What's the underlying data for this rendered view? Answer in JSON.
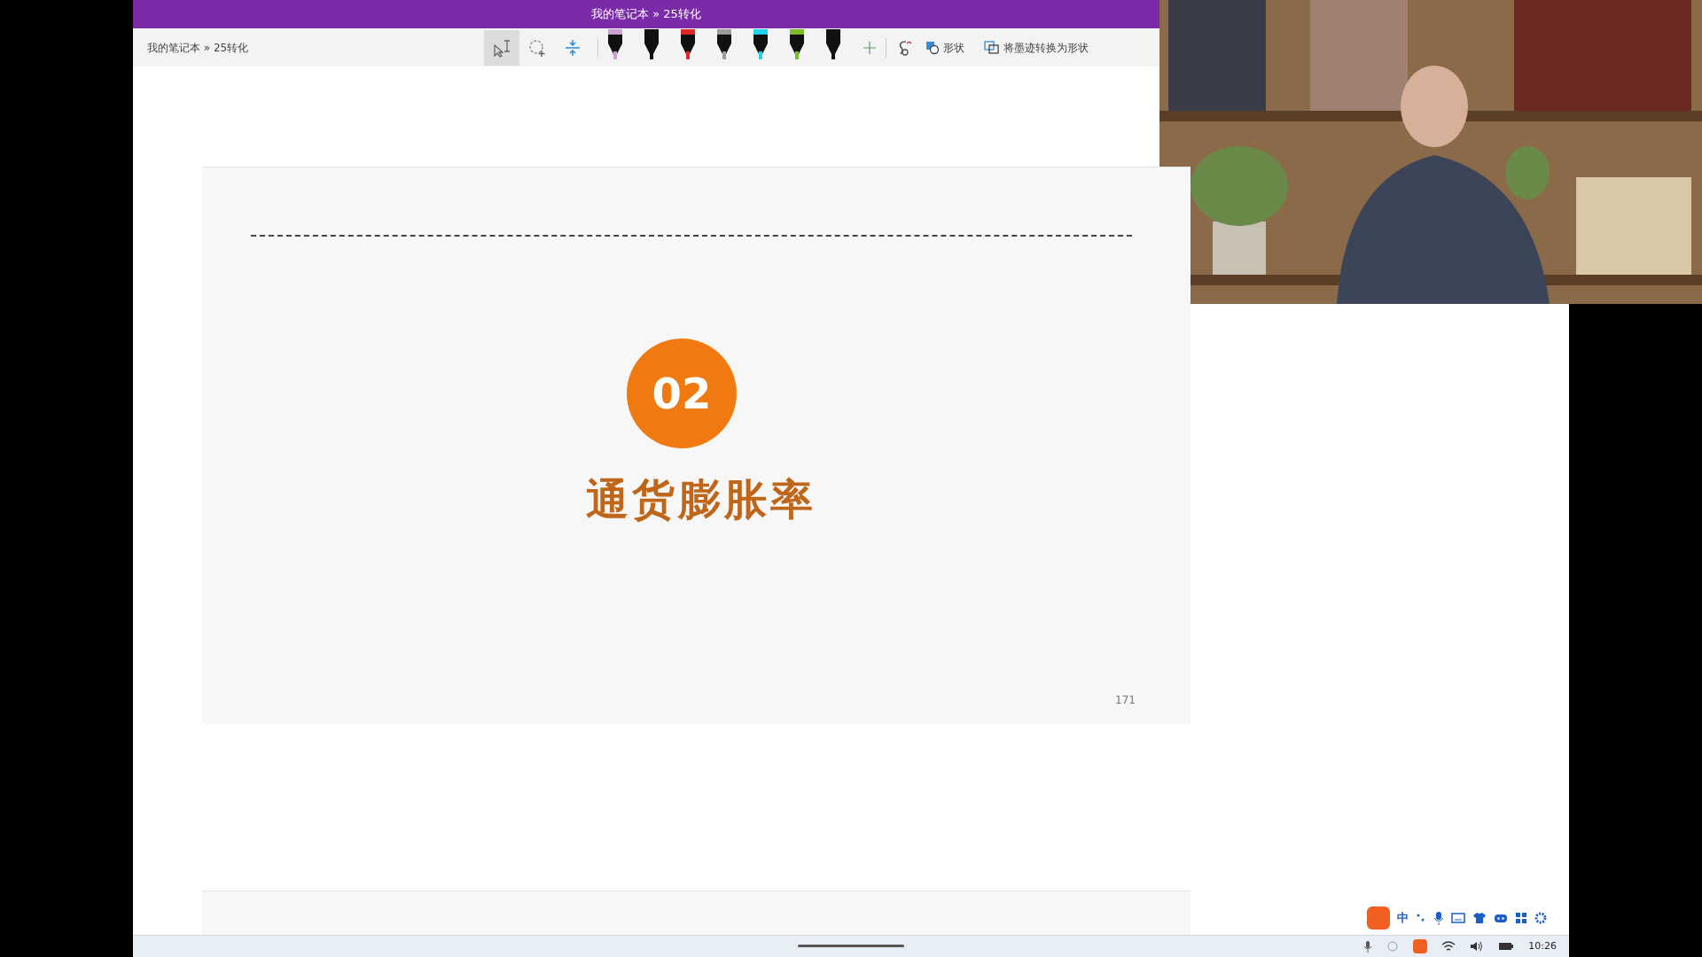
{
  "window": {
    "title": "我的笔记本 » 25转化"
  },
  "breadcrumb": "我的笔记本 » 25转化",
  "tools": [
    {
      "kind": "select",
      "selected": true
    },
    {
      "kind": "lasso",
      "selected": false
    },
    {
      "kind": "space",
      "selected": false
    }
  ],
  "pens": [
    {
      "color": "#c9a0d0"
    },
    {
      "color": "#111111"
    },
    {
      "color": "#e02828"
    },
    {
      "color": "#9a9a9a"
    },
    {
      "color": "#22d0f0"
    },
    {
      "color": "#7cbb2a"
    },
    {
      "color": "#111111"
    }
  ],
  "shape_button": "形状",
  "ink_to_shape_button": "将墨迹转换为形状",
  "slide": {
    "number": "02",
    "title": "通货膨胀率",
    "page": "171"
  },
  "ime": {
    "mode": "中"
  },
  "clock": "10:26"
}
